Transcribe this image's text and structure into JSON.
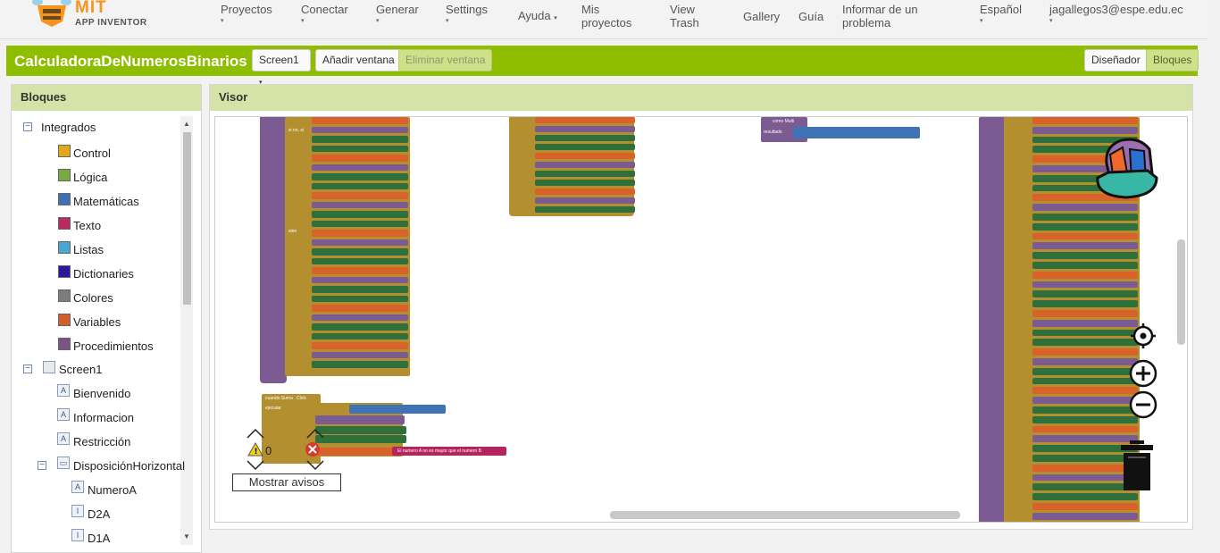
{
  "header": {
    "logo_mit": "MIT",
    "logo_sub": "APP INVENTOR",
    "nav": [
      {
        "label": "Proyectos",
        "caret": "▾"
      },
      {
        "label": "Conectar",
        "caret": "▾"
      },
      {
        "label": "Generar",
        "caret": "▾"
      },
      {
        "label": "Settings",
        "caret": "▾"
      },
      {
        "label": "Ayuda",
        "caret": "▾"
      },
      {
        "label": "Mis proyectos"
      },
      {
        "label": "View Trash"
      },
      {
        "label": "Gallery"
      },
      {
        "label": "Guía"
      },
      {
        "label": "Informar de un problema"
      },
      {
        "label": "Español",
        "caret": "▾"
      },
      {
        "label": "jagallegos3@espe.edu.ec",
        "caret": "▾"
      }
    ]
  },
  "project": {
    "name": "CalculadoraDeNumerosBinarios",
    "screen_select": "Screen1",
    "add_screen": "Añadir ventana",
    "remove_screen": "Eliminar ventana",
    "designer": "Diseñador",
    "blocks_btn": "Bloques"
  },
  "blocks_panel": {
    "title": "Bloques",
    "builtin": "Integrados",
    "categories": [
      {
        "label": "Control",
        "color": "#e1a91a"
      },
      {
        "label": "Lógica",
        "color": "#77ab41"
      },
      {
        "label": "Matemáticas",
        "color": "#3f71b5"
      },
      {
        "label": "Texto",
        "color": "#b32d5e"
      },
      {
        "label": "Listas",
        "color": "#49a6d4"
      },
      {
        "label": "Dictionaries",
        "color": "#2d1799"
      },
      {
        "label": "Colores",
        "color": "#7d7d7d"
      },
      {
        "label": "Variables",
        "color": "#d05f2d"
      },
      {
        "label": "Procedimientos",
        "color": "#7c5385"
      }
    ],
    "screen": "Screen1",
    "components": [
      "Bienvenido",
      "Informacion",
      "Restricción"
    ],
    "arrangement": "DisposiciónHorizontal",
    "sub_components": [
      "NumeroA",
      "D2A",
      "D1A"
    ]
  },
  "viewer": {
    "title": "Visor",
    "warning_count": "0",
    "show_warnings": "Mostrar avisos",
    "labels": {
      "si_no_si": "si no, si",
      "entonces": "entonces",
      "sino": "sino",
      "cuando": "cuando",
      "ejecutar": "ejecutar",
      "resultado": "resultado",
      "como": "como",
      "proc": "Multi",
      "event": "Suma . Click",
      "msg": "El numero A no es mayor que el numero B"
    }
  }
}
